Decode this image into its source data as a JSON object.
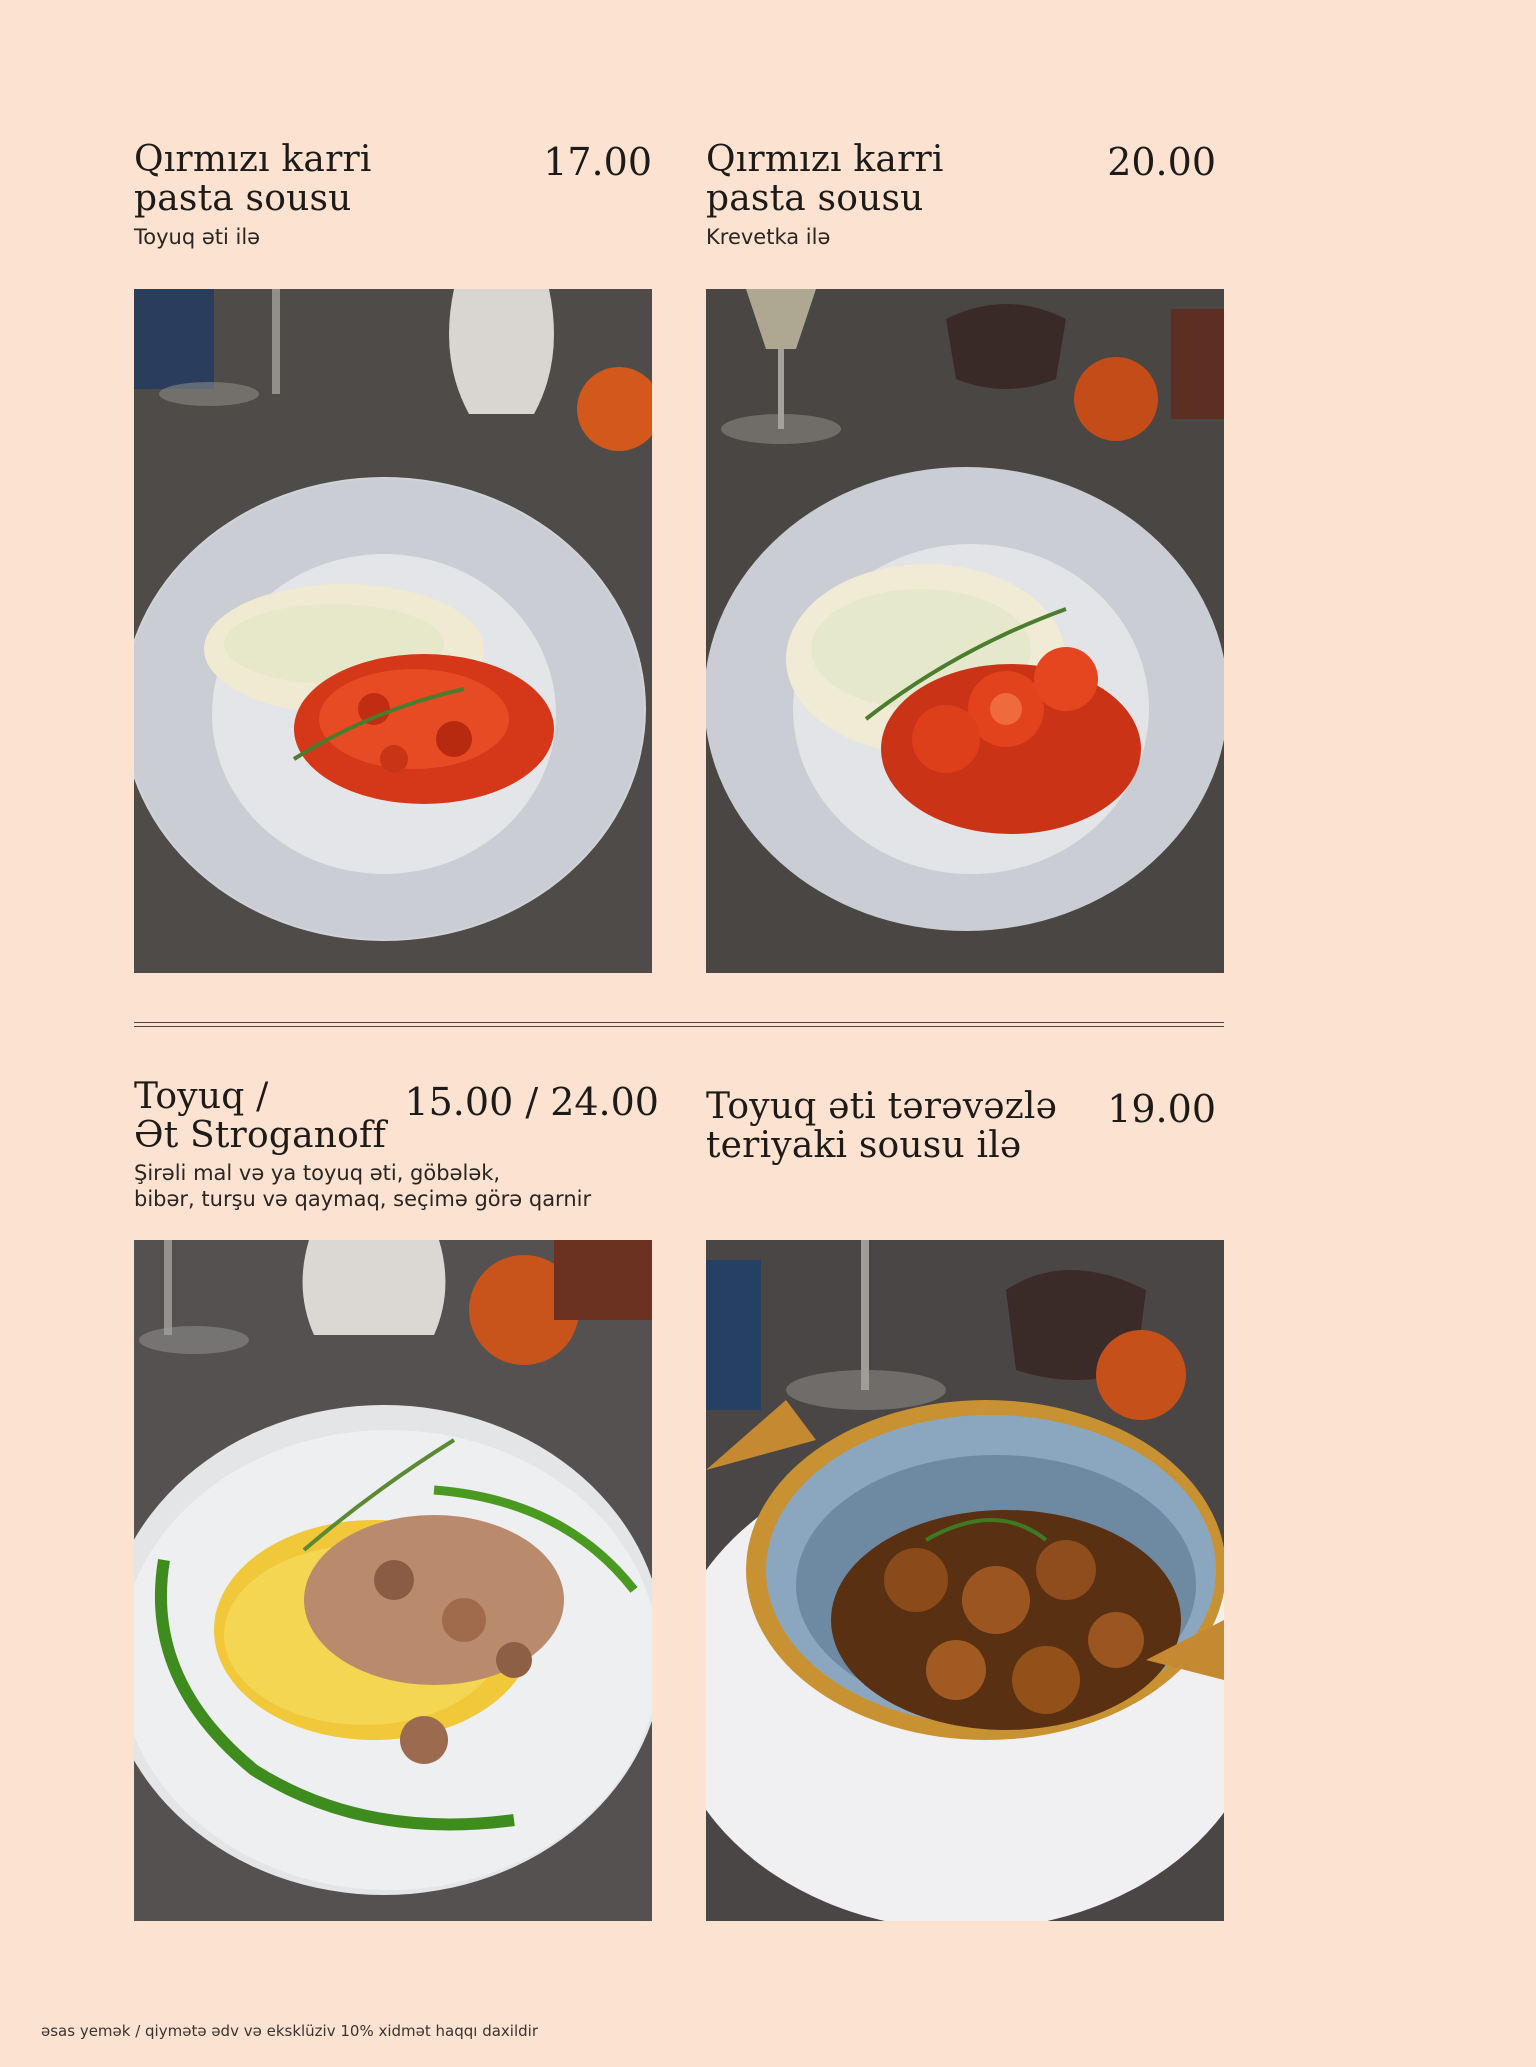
{
  "items": [
    {
      "title_lines": [
        "Qırmızı karri",
        "pasta sousu"
      ],
      "price": "17.00",
      "desc_lines": [
        "Toyuq əti ilə"
      ],
      "photo_icon": "red-curry-chicken-rice-dish"
    },
    {
      "title_lines": [
        "Qırmızı karri",
        "pasta sousu"
      ],
      "price": "20.00",
      "desc_lines": [
        "Krevetka ilə"
      ],
      "photo_icon": "red-curry-shrimp-rice-dish"
    },
    {
      "title_lines": [
        "Toyuq /",
        "Ət Stroganoff"
      ],
      "price": "15.00 / 24.00",
      "desc_lines": [
        "Şirəli mal və ya toyuq əti, göbələk,",
        "bibər, turşu və qaymaq, seçimə görə qarnir"
      ],
      "photo_icon": "stroganoff-mashed-potato-dish"
    },
    {
      "title_lines": [
        "Toyuq əti tərəvəzlə",
        "teriyaki sousu ilə"
      ],
      "price": "19.00",
      "desc_lines": [],
      "photo_icon": "teriyaki-chicken-pan-dish"
    }
  ],
  "footer": "əsas yemək / qiymətə ədv və eksklüziv 10% xidmət haqqı daxildir"
}
